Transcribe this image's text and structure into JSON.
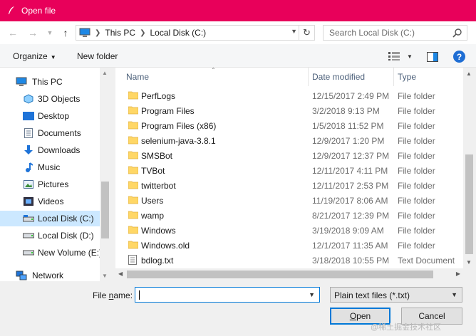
{
  "window": {
    "title": "Open file"
  },
  "address": {
    "crumbs": [
      "This PC",
      "Local Disk (C:)"
    ]
  },
  "search": {
    "placeholder": "Search Local Disk (C:)"
  },
  "toolbar": {
    "organize": "Organize",
    "new_folder": "New folder",
    "help": "?"
  },
  "nav": {
    "items": [
      {
        "label": "This PC",
        "icon": "pc-icon"
      },
      {
        "label": "3D Objects",
        "icon": "3d-objects-icon"
      },
      {
        "label": "Desktop",
        "icon": "desktop-icon"
      },
      {
        "label": "Documents",
        "icon": "documents-icon"
      },
      {
        "label": "Downloads",
        "icon": "download-icon"
      },
      {
        "label": "Music",
        "icon": "music-icon"
      },
      {
        "label": "Pictures",
        "icon": "pictures-icon"
      },
      {
        "label": "Videos",
        "icon": "videos-icon"
      },
      {
        "label": "Local Disk (C:)",
        "icon": "drive-icon",
        "selected": true
      },
      {
        "label": "Local Disk (D:)",
        "icon": "drive-icon"
      },
      {
        "label": "New Volume (E:)",
        "icon": "drive-icon"
      },
      {
        "label": "Network",
        "icon": "network-icon"
      }
    ]
  },
  "columns": {
    "name": "Name",
    "date": "Date modified",
    "type": "Type"
  },
  "files": [
    {
      "name": "PerfLogs",
      "date": "12/15/2017 2:49 PM",
      "type": "File folder",
      "icon": "folder-icon"
    },
    {
      "name": "Program Files",
      "date": "3/2/2018 9:13 PM",
      "type": "File folder",
      "icon": "folder-icon"
    },
    {
      "name": "Program Files (x86)",
      "date": "1/5/2018 11:52 PM",
      "type": "File folder",
      "icon": "folder-icon"
    },
    {
      "name": "selenium-java-3.8.1",
      "date": "12/9/2017 1:20 PM",
      "type": "File folder",
      "icon": "folder-icon"
    },
    {
      "name": "SMSBot",
      "date": "12/9/2017 12:37 PM",
      "type": "File folder",
      "icon": "folder-icon"
    },
    {
      "name": "TVBot",
      "date": "12/11/2017 4:11 PM",
      "type": "File folder",
      "icon": "folder-icon"
    },
    {
      "name": "twitterbot",
      "date": "12/11/2017 2:53 PM",
      "type": "File folder",
      "icon": "folder-icon"
    },
    {
      "name": "Users",
      "date": "11/19/2017 8:06 AM",
      "type": "File folder",
      "icon": "folder-icon"
    },
    {
      "name": "wamp",
      "date": "8/21/2017 12:39 PM",
      "type": "File folder",
      "icon": "folder-icon"
    },
    {
      "name": "Windows",
      "date": "3/19/2018 9:09 AM",
      "type": "File folder",
      "icon": "folder-icon"
    },
    {
      "name": "Windows.old",
      "date": "12/1/2017 11:35 AM",
      "type": "File folder",
      "icon": "folder-icon"
    },
    {
      "name": "bdlog.txt",
      "date": "3/18/2018 10:55 PM",
      "type": "Text Document",
      "icon": "text-file-icon"
    }
  ],
  "bottom": {
    "file_name_value": "",
    "file_type": "Plain text files (*.txt)"
  },
  "watermark": "@稀土掘金技术社区",
  "colors": {
    "titlebar": "#e8005a",
    "selection": "#cce8ff",
    "accent": "#0078d7",
    "folder": "#ffd766"
  }
}
